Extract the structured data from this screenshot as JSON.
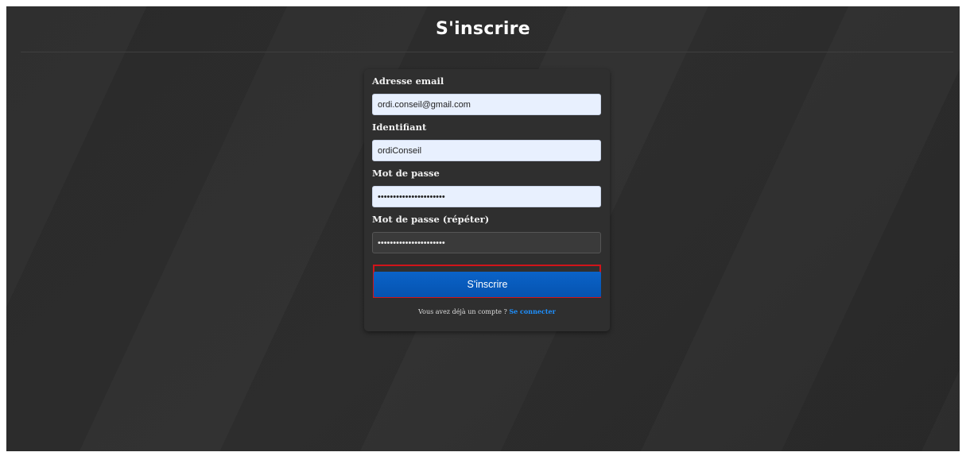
{
  "page": {
    "title": "S'inscrire"
  },
  "form": {
    "email": {
      "label": "Adresse email",
      "value": "ordi.conseil@gmail.com"
    },
    "username": {
      "label": "Identifiant",
      "value": "ordiConseil"
    },
    "password": {
      "label": "Mot de passe",
      "value": "••••••••••••••••••••••"
    },
    "password_repeat": {
      "label": "Mot de passe (répéter)",
      "value": "••••••••••••••••••••••"
    },
    "submit_label": "S'inscrire",
    "login_prompt": "Vous avez déjà un compte ?",
    "login_link": "Se connecter"
  },
  "colors": {
    "background": "#2b2b2b",
    "card": "#2f2f2f",
    "autofill_input": "#e8f0fe",
    "button": "#0553b0",
    "link": "#1e90ff",
    "highlight": "#d0141a"
  }
}
